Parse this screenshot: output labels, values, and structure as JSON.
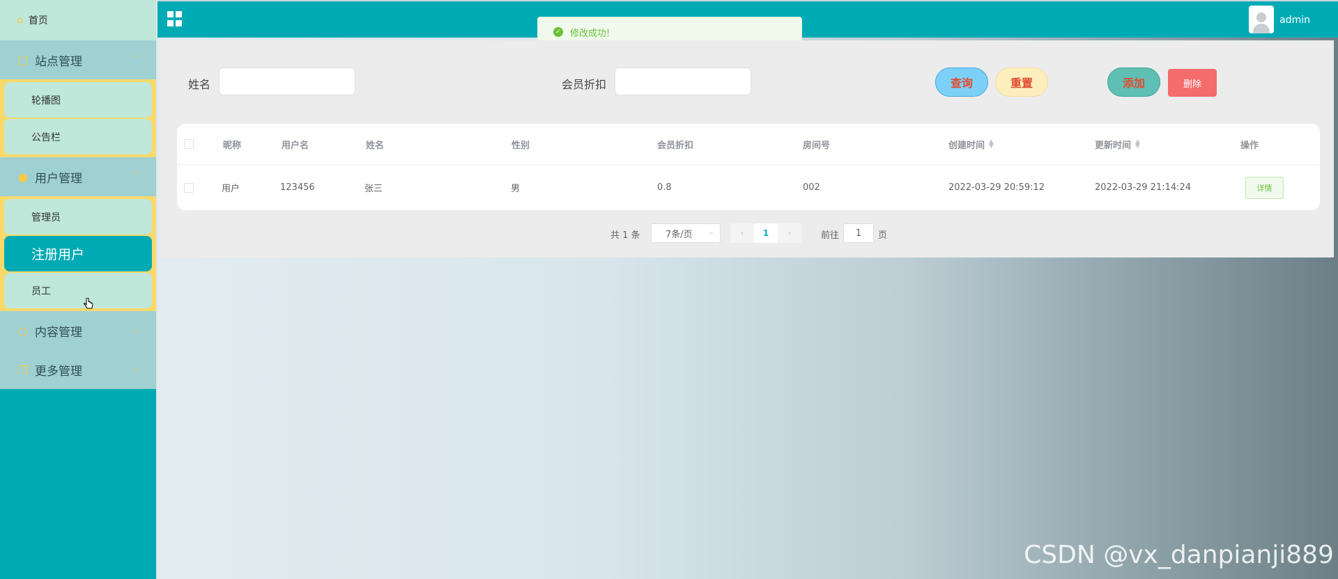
{
  "header": {
    "title": "",
    "username": "admin"
  },
  "toast": {
    "message": "修改成功!"
  },
  "sidebar": {
    "home": "首页",
    "groups": [
      {
        "label": "站点管理",
        "icon": "display-icon",
        "expanded": true,
        "items": [
          "轮播图",
          "公告栏"
        ]
      },
      {
        "label": "用户管理",
        "icon": "user-icon",
        "expanded": true,
        "items": [
          "管理员",
          "注册用户",
          "员工"
        ],
        "active": "注册用户"
      },
      {
        "label": "内容管理",
        "icon": "message-icon",
        "expanded": false,
        "items": []
      },
      {
        "label": "更多管理",
        "icon": "copy-icon",
        "expanded": false,
        "items": []
      }
    ]
  },
  "search": {
    "name_label": "姓名",
    "name_value": "",
    "discount_label": "会员折扣",
    "discount_value": ""
  },
  "buttons": {
    "query": "查询",
    "reset": "重置",
    "add": "添加",
    "delete": "删除"
  },
  "table": {
    "columns": [
      "昵称",
      "用户名",
      "姓名",
      "性别",
      "会员折扣",
      "房间号",
      "创建时间",
      "更新时间",
      "操作"
    ],
    "rows": [
      {
        "nickname": "用户",
        "username": "123456",
        "name": "张三",
        "gender": "男",
        "discount": "0.8",
        "room": "002",
        "created": "2022-03-29 20:59:12",
        "updated": "2022-03-29 21:14:24",
        "action": "详情"
      }
    ]
  },
  "pagination": {
    "total": "共 1 条",
    "page_size": "7条/页",
    "current": "1",
    "goto_label": "前往",
    "goto_value": "1",
    "page_suffix": "页"
  },
  "watermark": "CSDN @vx_danpianji889",
  "colors": {
    "primary": "#00aab4",
    "menu": "#9fd0d2",
    "submenu_bg": "#f8d96a",
    "item": "#bfe8da",
    "icon": "#f7c948",
    "danger": "#f56c6c",
    "success": "#67c23a"
  }
}
